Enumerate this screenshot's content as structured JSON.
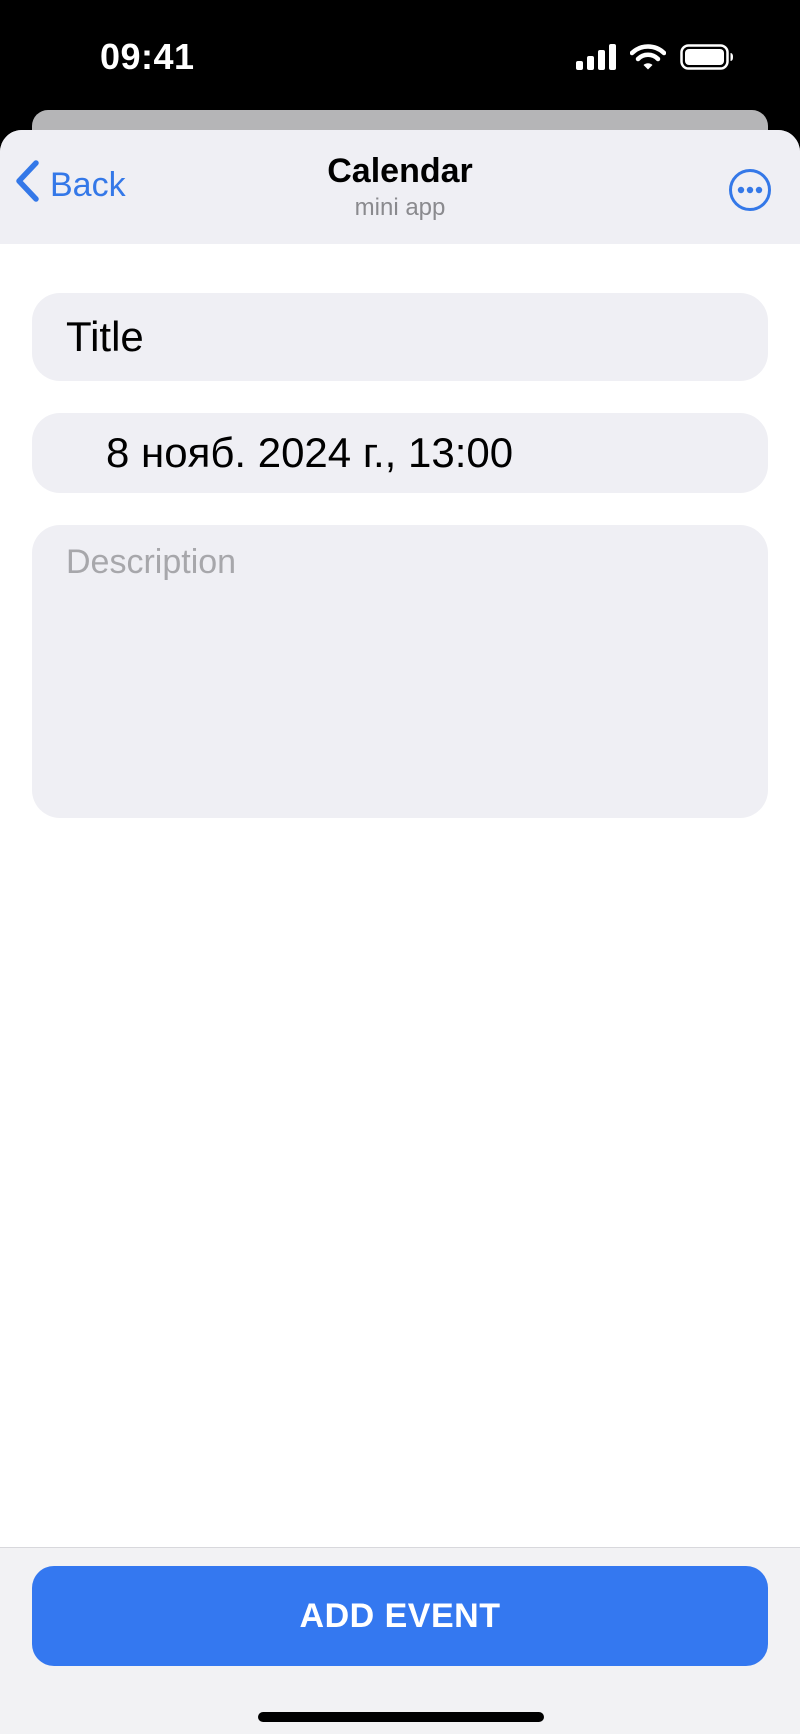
{
  "status_bar": {
    "time": "09:41"
  },
  "header": {
    "back_label": "Back",
    "title": "Calendar",
    "subtitle": "mini app"
  },
  "form": {
    "title_value": "Title",
    "date_value": "8 нояб. 2024 г., 13:00",
    "description_placeholder": "Description"
  },
  "bottom": {
    "add_event_label": "ADD EVENT"
  },
  "icons": {
    "back": "chevron-left-icon",
    "more": "more-icon",
    "signal": "signal-icon",
    "wifi": "wifi-icon",
    "battery": "battery-icon"
  },
  "colors": {
    "accent": "#3478e8",
    "button": "#3478f0",
    "field_bg": "#efeff4"
  }
}
